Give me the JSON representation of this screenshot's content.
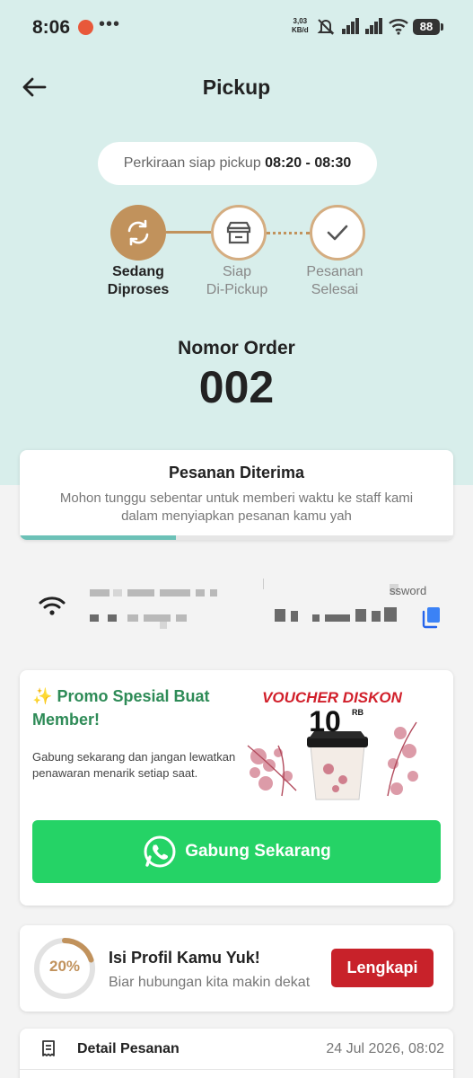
{
  "status_bar": {
    "time": "8:06",
    "more": "•••",
    "speed_value": "3,03",
    "speed_unit": "KB/d",
    "battery": "88"
  },
  "header": {
    "title": "Pickup",
    "back_icon": "arrow-left-icon"
  },
  "eta": {
    "label": "Perkiraan siap pickup",
    "time": "08:20 - 08:30"
  },
  "steps": [
    {
      "line1": "Sedang",
      "line2": "Diproses",
      "icon": "refresh-icon",
      "state": "active"
    },
    {
      "line1": "Siap",
      "line2": "Di-Pickup",
      "icon": "store-icon",
      "state": "pending"
    },
    {
      "line1": "Pesanan",
      "line2": "Selesai",
      "icon": "check-icon",
      "state": "pending"
    }
  ],
  "order": {
    "label": "Nomor Order",
    "number": "002"
  },
  "status_card": {
    "title": "Pesanan Diterima",
    "message": "Mohon tunggu sebentar untuk memberi waktu ke staff kami dalam menyiapkan pesanan kamu yah",
    "progress": 0.36
  },
  "wifi": {
    "password_label": "ssword",
    "copy_icon": "copy-icon",
    "wifi_icon": "wifi-icon"
  },
  "promo": {
    "title_emoji": "✨",
    "title": "Promo Spesial Buat Member!",
    "description": "Gabung sekarang dan jangan lewatkan penawaran menarik setiap saat.",
    "voucher_title": "VOUCHER DISKON",
    "voucher_amount": "10",
    "voucher_unit": "RB",
    "button_label": "Gabung Sekarang",
    "button_icon": "whatsapp-icon"
  },
  "profile": {
    "percent_label": "20%",
    "percent": 0.2,
    "title": "Isi Profil Kamu Yuk!",
    "subtitle": "Biar hubungan kita makin dekat",
    "button_label": "Lengkapi"
  },
  "detail": {
    "title": "Detail Pesanan",
    "date": "24 Jul 2026, 08:02",
    "icon": "receipt-icon"
  },
  "colors": {
    "header_bg": "#d8eeeb",
    "accent_brown": "#c1925c",
    "promo_green": "#2e8b57",
    "whatsapp_green": "#25d366",
    "button_red": "#c8222a",
    "progress_teal": "#6cc1b7"
  }
}
